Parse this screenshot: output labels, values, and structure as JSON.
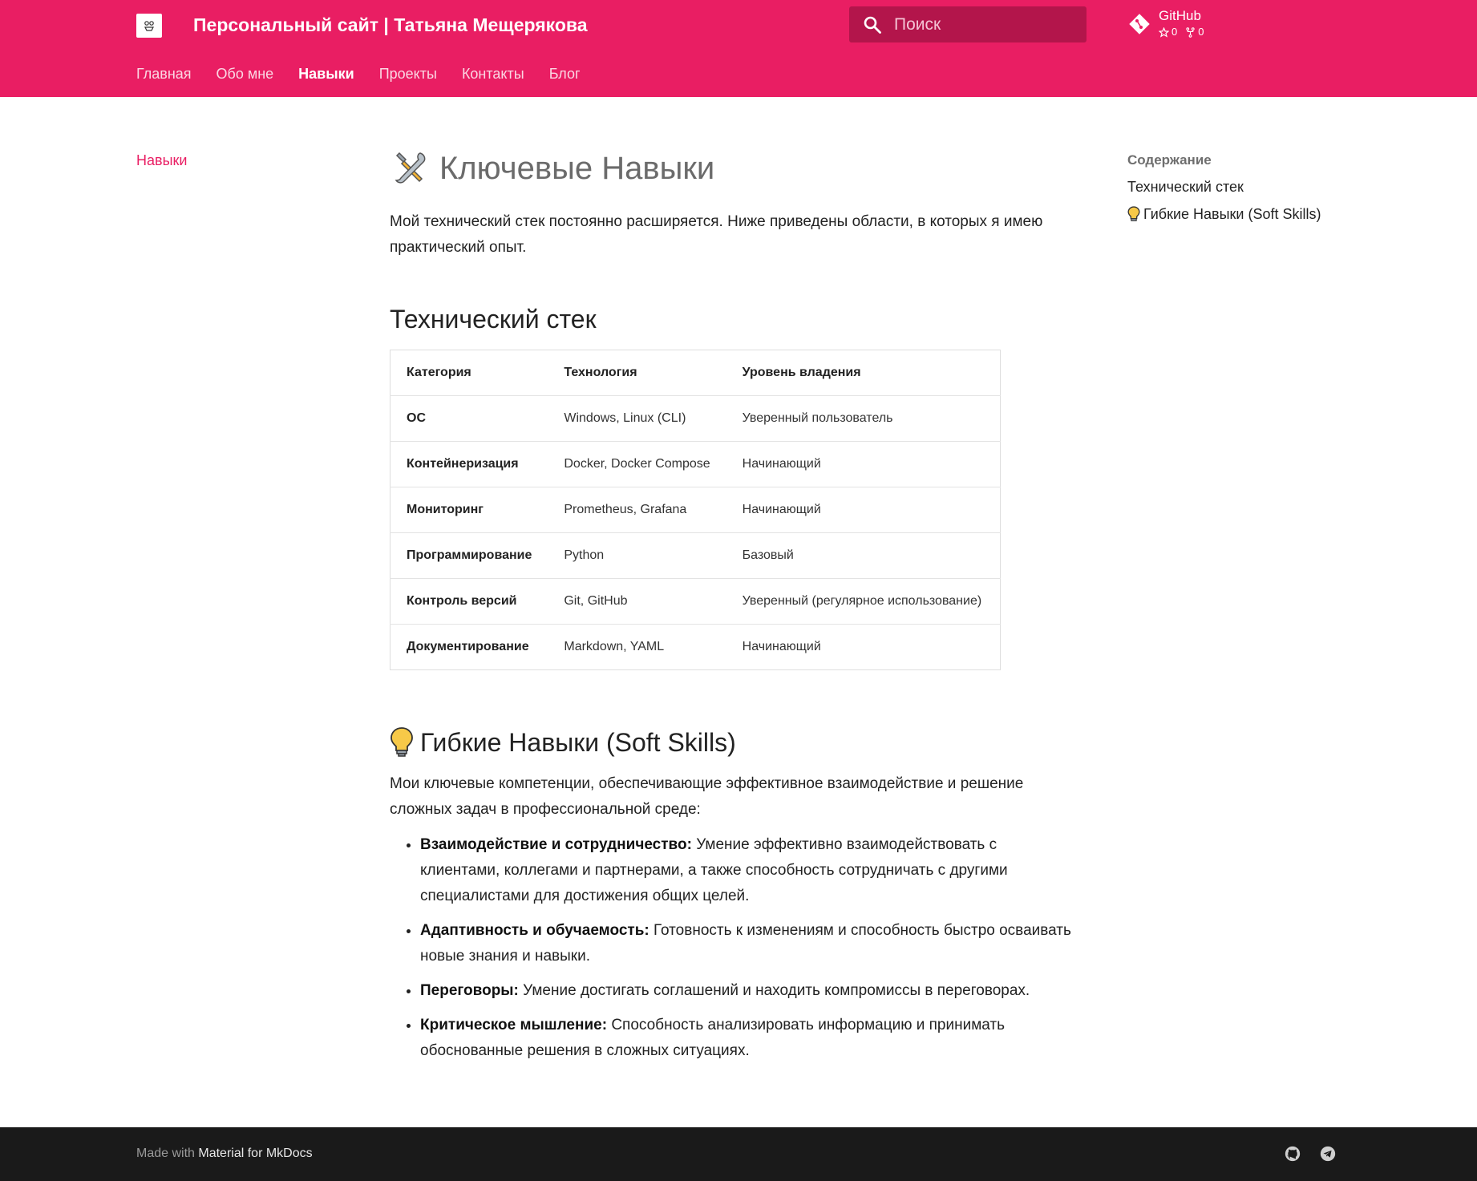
{
  "header": {
    "site_title": "Персональный сайт | Татьяна Мещерякова",
    "search_placeholder": "Поиск",
    "repo": {
      "name": "GitHub",
      "stars": "0",
      "forks": "0"
    },
    "tabs": [
      {
        "label": "Главная",
        "active": false
      },
      {
        "label": "Обо мне",
        "active": false
      },
      {
        "label": "Навыки",
        "active": true
      },
      {
        "label": "Проекты",
        "active": false
      },
      {
        "label": "Контакты",
        "active": false
      },
      {
        "label": "Блог",
        "active": false
      }
    ]
  },
  "left_nav": {
    "active_item": "Навыки"
  },
  "toc": {
    "title": "Содержание",
    "items": [
      "Технический стек",
      "Гибкие Навыки (Soft Skills)"
    ]
  },
  "main": {
    "title": "Ключевые Навыки",
    "intro": "Мой технический стек постоянно расширяется. Ниже приведены области, в которых я имею практический опыт.",
    "tech_heading": "Технический стек",
    "table": {
      "headers": [
        "Категория",
        "Технология",
        "Уровень владения"
      ],
      "rows": [
        [
          "ОС",
          "Windows, Linux (CLI)",
          "Уверенный пользователь"
        ],
        [
          "Контейнеризация",
          "Docker, Docker Compose",
          "Начинающий"
        ],
        [
          "Мониторинг",
          "Prometheus, Grafana",
          "Начинающий"
        ],
        [
          "Программирование",
          "Python",
          "Базовый"
        ],
        [
          "Контроль версий",
          "Git, GitHub",
          "Уверенный (регулярное использование)"
        ],
        [
          "Документирование",
          "Markdown, YAML",
          "Начинающий"
        ]
      ]
    },
    "soft_heading": "Гибкие Навыки (Soft Skills)",
    "soft_intro": "Мои ключевые компетенции, обеспечивающие эффективное взаимодействие и решение сложных задач в профессиональной среде:",
    "skills": [
      {
        "title": "Взаимодействие и сотрудничество:",
        "text": "Умение эффективно взаимодействовать с клиентами, коллегами и партнерами, а также способность сотрудничать с другими специалистами для достижения общих целей."
      },
      {
        "title": "Адаптивность и обучаемость:",
        "text": "Готовность к изменениям и способность быстро осваивать новые знания и навыки."
      },
      {
        "title": "Переговоры:",
        "text": "Умение достигать соглашений и находить компромиссы в переговорах."
      },
      {
        "title": "Критическое мышление:",
        "text": "Способность анализировать информацию и принимать обоснованные решения в сложных ситуациях."
      }
    ]
  },
  "footer": {
    "made_with": "Made with",
    "brand": "Material for MkDocs"
  },
  "icons": [
    "site-logo-icon",
    "search-icon",
    "git-icon",
    "star-icon",
    "fork-icon",
    "tools-icon",
    "lightbulb-icon",
    "github-icon",
    "telegram-icon"
  ],
  "colors": {
    "primary": "#e91e63",
    "search_bg": "#b3154b",
    "footer_bg": "#1a1a1a"
  }
}
